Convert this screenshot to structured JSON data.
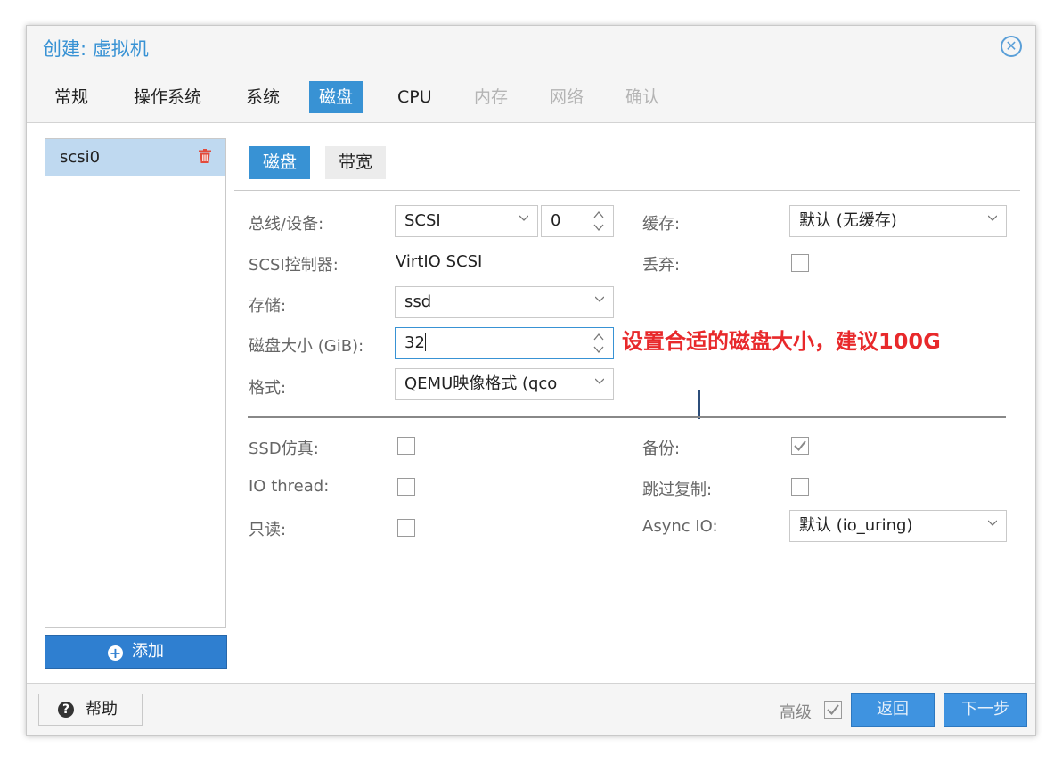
{
  "window": {
    "title": "创建: 虚拟机",
    "close_icon": "close-circle-icon"
  },
  "tabs": [
    {
      "label": "常规",
      "state": "normal"
    },
    {
      "label": "操作系统",
      "state": "normal"
    },
    {
      "label": "系统",
      "state": "normal"
    },
    {
      "label": "磁盘",
      "state": "active"
    },
    {
      "label": "CPU",
      "state": "normal"
    },
    {
      "label": "内存",
      "state": "disabled"
    },
    {
      "label": "网络",
      "state": "disabled"
    },
    {
      "label": "确认",
      "state": "disabled"
    }
  ],
  "disk_list": {
    "items": [
      {
        "label": "scsi0",
        "selected": true
      }
    ],
    "add_button": "添加"
  },
  "subtabs": {
    "disk": "磁盘",
    "bandwidth": "带宽"
  },
  "form": {
    "bus_device": {
      "label": "总线/设备:",
      "bus": "SCSI",
      "device": "0"
    },
    "scsi_controller": {
      "label": "SCSI控制器:",
      "value": "VirtIO SCSI"
    },
    "storage": {
      "label": "存储:",
      "value": "ssd"
    },
    "disk_size": {
      "label": "磁盘大小 (GiB):",
      "value": "32"
    },
    "format": {
      "label": "格式:",
      "value": "QEMU映像格式 (qco"
    },
    "cache": {
      "label": "缓存:",
      "value": "默认 (无缓存)"
    },
    "discard": {
      "label": "丢弃:",
      "checked": false
    },
    "ssd_emulation": {
      "label": "SSD仿真:",
      "checked": false
    },
    "io_thread": {
      "label": "IO thread:",
      "checked": false
    },
    "read_only": {
      "label": "只读:",
      "checked": false
    },
    "backup": {
      "label": "备份:",
      "checked": true
    },
    "skip_replication": {
      "label": "跳过复制:",
      "checked": false
    },
    "async_io": {
      "label": "Async IO:",
      "value": "默认 (io_uring)"
    }
  },
  "annotation": "设置合适的磁盘大小，建议100G",
  "footer": {
    "help": "帮助",
    "advanced": "高级",
    "advanced_checked": true,
    "back": "返回",
    "next": "下一步"
  },
  "colors": {
    "accent": "#3892d4",
    "annotation": "#e8292b",
    "delete": "#e34b3b"
  }
}
